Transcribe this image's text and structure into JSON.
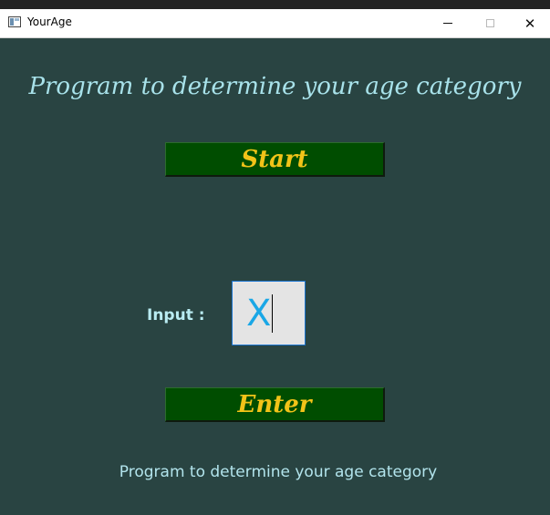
{
  "window": {
    "title": "YourAge",
    "icon": "app-window-icon",
    "controls": {
      "minimize_icon": "minimize-icon",
      "maximize_icon": "maximize-icon",
      "close_icon": "close-icon",
      "close_glyph": "✕"
    }
  },
  "main": {
    "heading": "Program to determine your age category",
    "start_button": "Start",
    "input_label": "Input :",
    "input_value": "X",
    "enter_button": "Enter",
    "footer_text": "Program to determine your age category"
  },
  "colors": {
    "background": "#294442",
    "button_bg": "#004d00",
    "button_text": "#f2c318",
    "heading_text": "#a8e2ea",
    "input_text": "#1aa7e6"
  }
}
